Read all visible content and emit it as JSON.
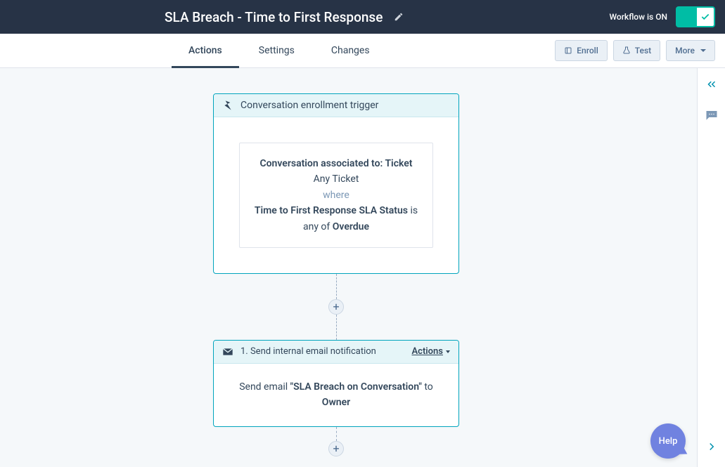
{
  "header": {
    "title": "SLA Breach - Time to First Response",
    "workflow_status": "Workflow is ON"
  },
  "tabs": {
    "actions": "Actions",
    "settings": "Settings",
    "changes": "Changes"
  },
  "buttons": {
    "enroll": "Enroll",
    "test": "Test",
    "more": "More"
  },
  "trigger": {
    "header": "Conversation enrollment trigger",
    "line1_bold": "Conversation associated to: Ticket",
    "line2": "Any Ticket",
    "where": "where",
    "line4_bold": "Time to First Response SLA Status",
    "line4_rest": " is any of ",
    "line4_value": "Overdue"
  },
  "action1": {
    "header": "1. Send internal email notification",
    "actions_label": "Actions",
    "body_prefix": "Send email ",
    "body_email": "\"SLA Breach on Conversation\"",
    "body_to": " to ",
    "body_owner": "Owner"
  },
  "help": "Help"
}
